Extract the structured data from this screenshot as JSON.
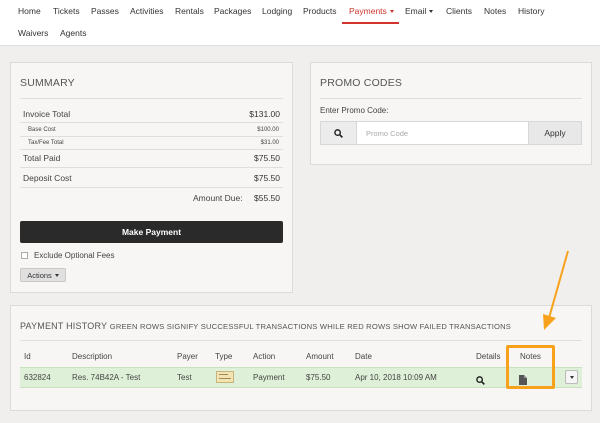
{
  "nav": {
    "row1": [
      "Home",
      "Tickets",
      "Passes",
      "Activities",
      "Rentals",
      "Packages",
      "Lodging",
      "Products",
      "Payments",
      "Email",
      "Clients",
      "Notes",
      "History"
    ],
    "row2": [
      "Waivers",
      "Agents"
    ],
    "active": "Payments"
  },
  "summary": {
    "title": "SUMMARY",
    "invoice_total_label": "Invoice Total",
    "invoice_total_value": "$131.00",
    "base_cost_label": "Base Cost",
    "base_cost_value": "$100.00",
    "tax_fee_label": "Tax/Fee Total",
    "tax_fee_value": "$31.00",
    "total_paid_label": "Total Paid",
    "total_paid_value": "$75.50",
    "deposit_label": "Deposit Cost",
    "deposit_value": "$75.50",
    "amount_due_label": "Amount Due:",
    "amount_due_value": "$55.50",
    "make_payment_label": "Make Payment",
    "exclude_label": "Exclude Optional Fees",
    "actions_label": "Actions"
  },
  "promo": {
    "title": "PROMO CODES",
    "enter_label": "Enter Promo Code:",
    "placeholder": "Promo Code",
    "apply_label": "Apply"
  },
  "history": {
    "title": "PAYMENT HISTORY",
    "subtitle": "GREEN ROWS SIGNIFY SUCCESSFUL TRANSACTIONS WHILE RED ROWS SHOW FAILED TRANSACTIONS",
    "columns": {
      "id": "Id",
      "description": "Description",
      "payer": "Payer",
      "type": "Type",
      "action": "Action",
      "amount": "Amount",
      "date": "Date",
      "details": "Details",
      "notes": "Notes"
    },
    "rows": [
      {
        "id": "632824",
        "description": "Res. 74B42A - Test",
        "payer": "Test",
        "type_icon": "check-icon",
        "action": "Payment",
        "amount": "$75.50",
        "date": "Apr 10, 2018 10:09 AM",
        "status": "success"
      }
    ]
  },
  "colors": {
    "accent": "#d0342c",
    "success_row": "#dff0d8",
    "highlight": "#f7a21a",
    "button_dark": "#2a2a2a"
  }
}
